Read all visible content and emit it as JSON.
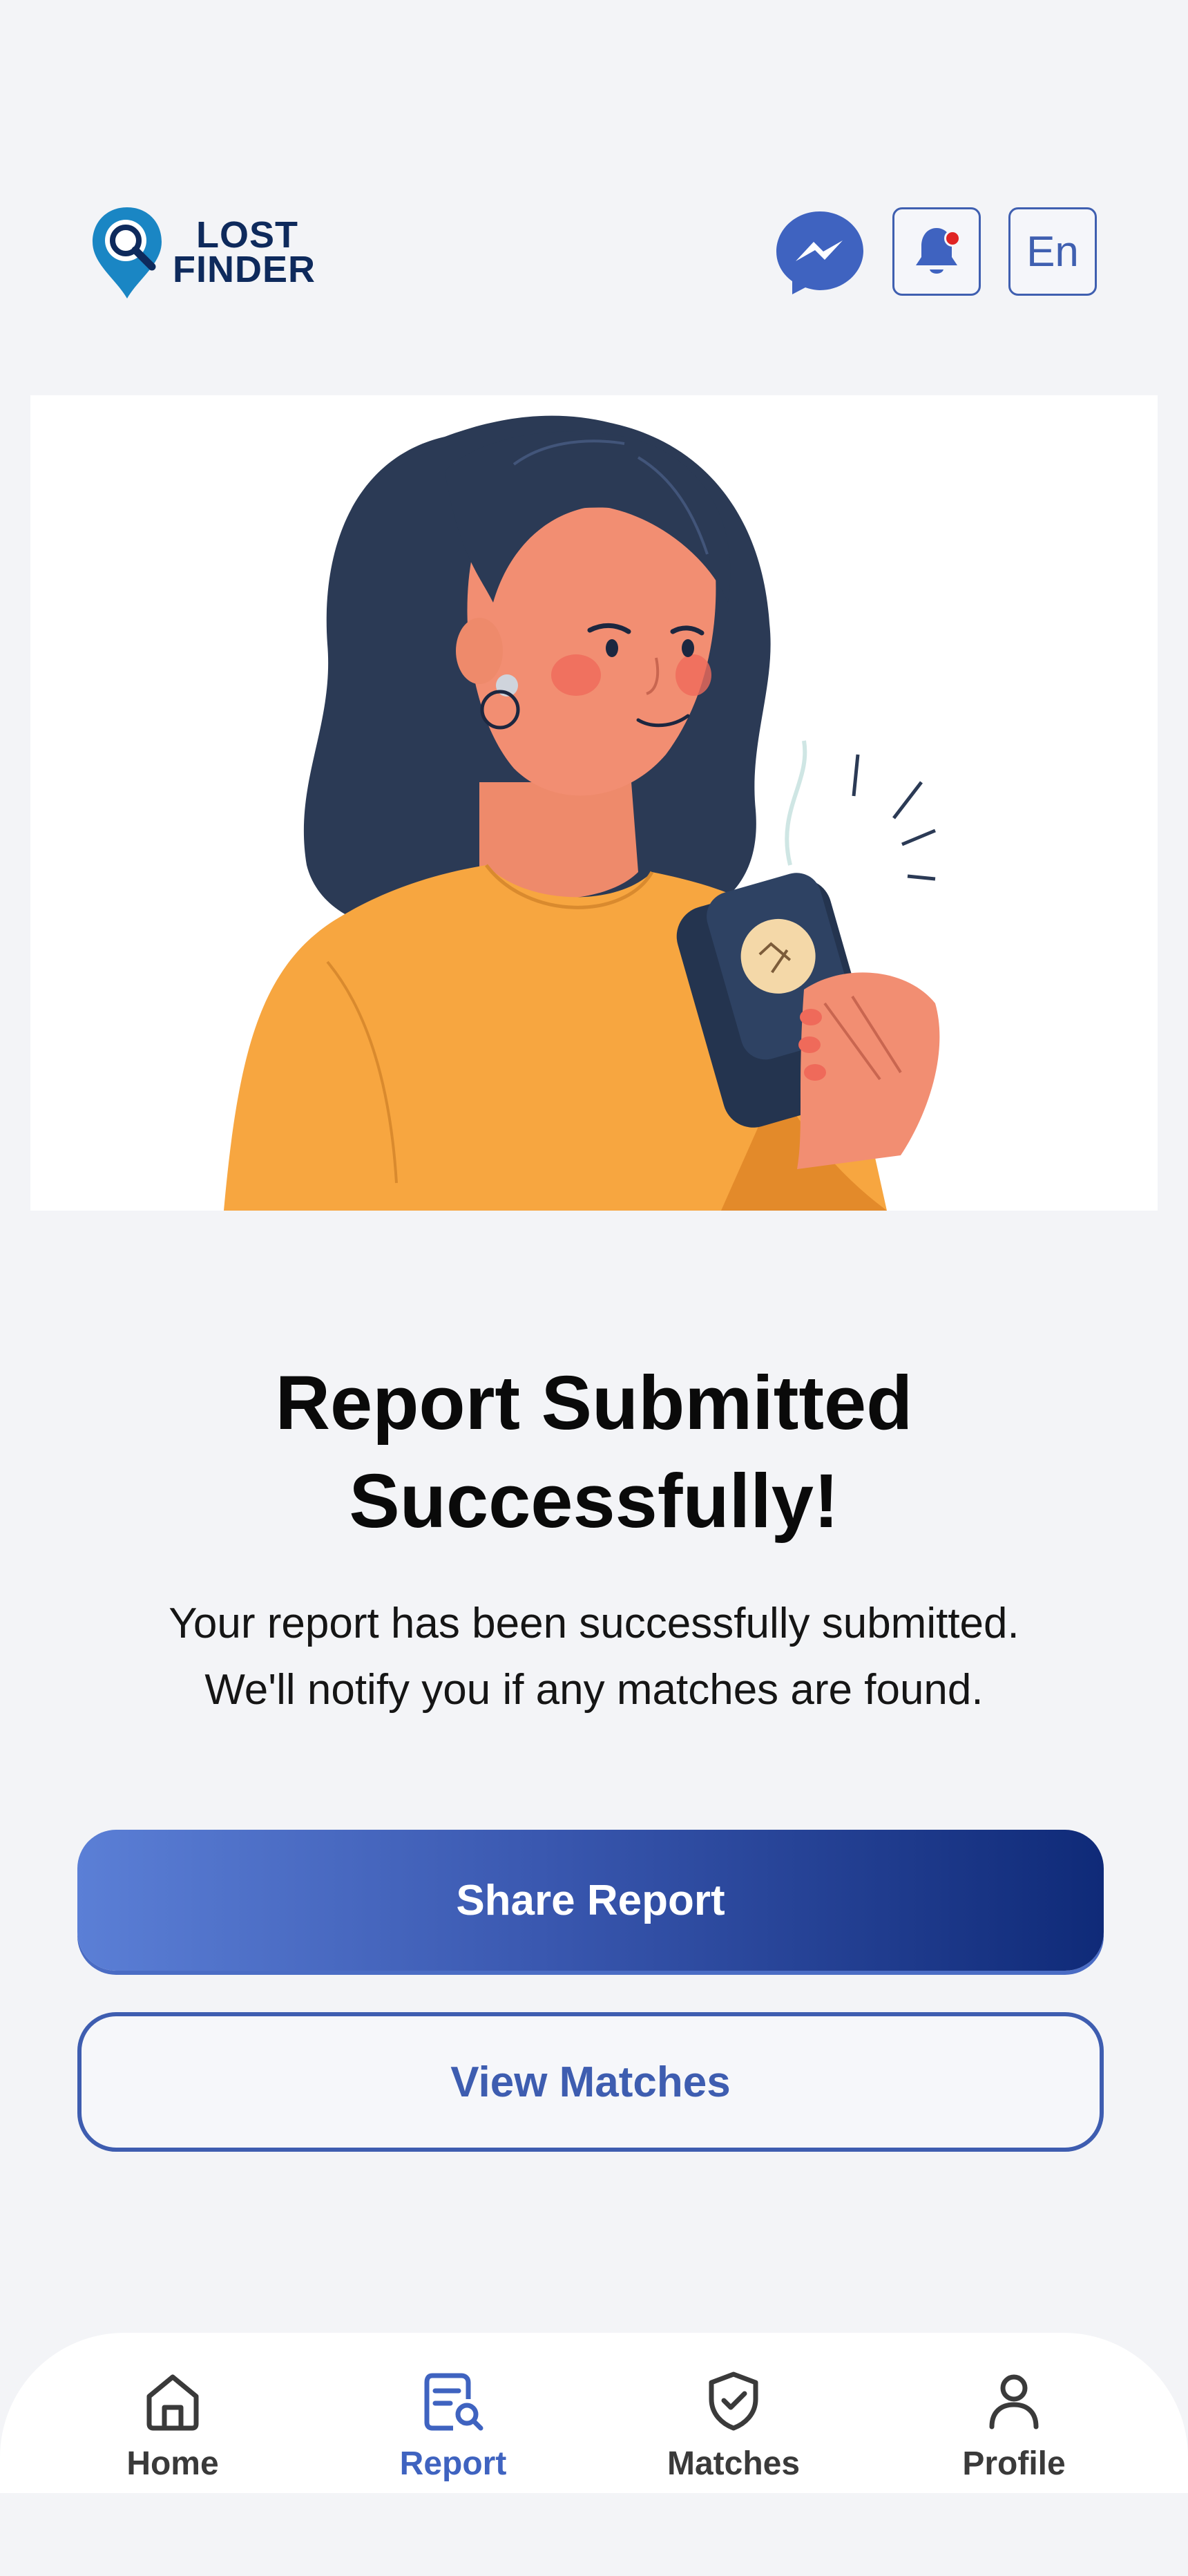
{
  "header": {
    "logo_line1": "LOST",
    "logo_line2": "FINDER",
    "messenger_icon": "messenger-icon",
    "notification_icon": "bell-icon",
    "language_label": "En"
  },
  "hero": {
    "illustration": "woman-holding-wallet-illustration"
  },
  "message": {
    "title_line1": "Report Submitted",
    "title_line2": "Successfully!",
    "subtitle_line1": "Your report has been successfully submitted.",
    "subtitle_line2": "We'll notify you if any matches are found."
  },
  "actions": {
    "share_label": "Share Report",
    "view_matches_label": "View Matches"
  },
  "bottom_nav": {
    "items": [
      {
        "label": "Home",
        "icon": "home-icon",
        "active": false
      },
      {
        "label": "Report",
        "icon": "report-icon",
        "active": true
      },
      {
        "label": "Matches",
        "icon": "shield-check-icon",
        "active": false
      },
      {
        "label": "Profile",
        "icon": "user-icon",
        "active": false
      }
    ]
  },
  "colors": {
    "background": "#f3f4f7",
    "primary": "#3f5fb0",
    "primary_dark": "#0f2a78",
    "notification_dot": "#e02424",
    "logo": "#0e2a5c"
  }
}
